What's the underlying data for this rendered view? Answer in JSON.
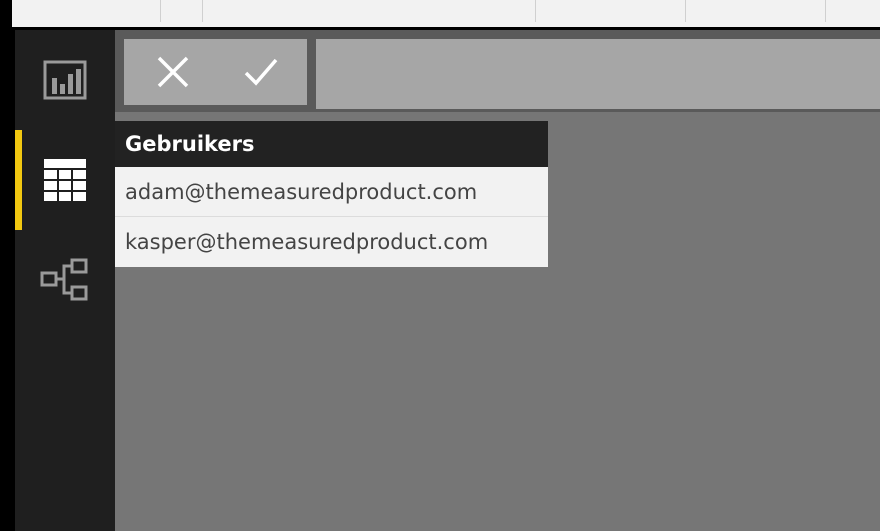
{
  "sidebar": {
    "items": [
      {
        "icon": "report-view-icon",
        "active": false
      },
      {
        "icon": "data-view-icon",
        "active": true
      },
      {
        "icon": "model-view-icon",
        "active": false
      }
    ],
    "active_color": "#f2c811"
  },
  "formula_bar": {
    "cancel_icon": "close-icon",
    "commit_icon": "check-icon",
    "value": ""
  },
  "table": {
    "columns": [
      "Gebruikers"
    ],
    "rows": [
      [
        "adam@themeasuredproduct.com"
      ],
      [
        "kasper@themeasuredproduct.com"
      ]
    ]
  }
}
